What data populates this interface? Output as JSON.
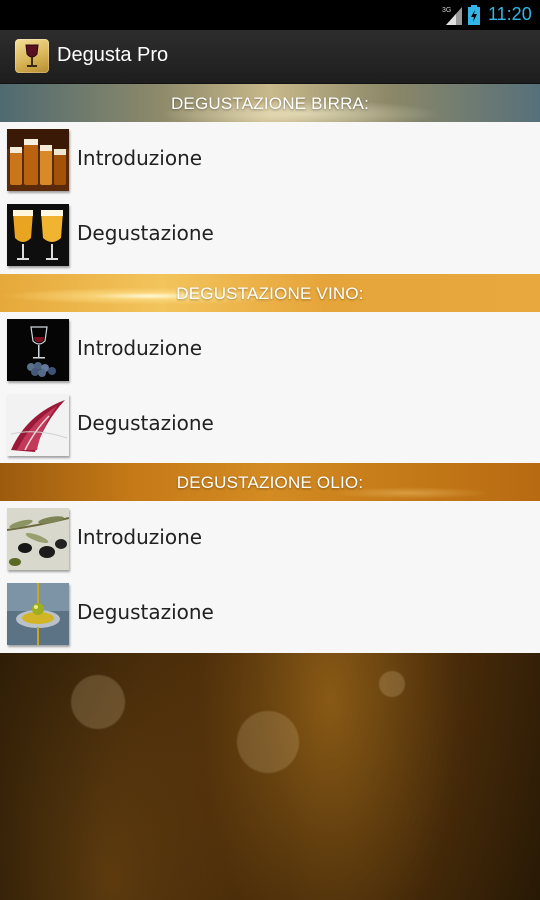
{
  "status_bar": {
    "network_label": "3G",
    "time": "11:20",
    "icons": [
      "signal-icon",
      "battery-icon"
    ]
  },
  "action_bar": {
    "app_icon": "wine-glass-icon",
    "title": "Degusta Pro"
  },
  "sections": [
    {
      "header": "DEGUSTAZIONE BIRRA:",
      "items": [
        {
          "label": "Introduzione",
          "thumbnail": "beer-glasses-image"
        },
        {
          "label": "Degustazione",
          "thumbnail": "beer-tasting-image"
        }
      ]
    },
    {
      "header": "DEGUSTAZIONE VINO:",
      "items": [
        {
          "label": "Introduzione",
          "thumbnail": "wine-glass-grapes-image"
        },
        {
          "label": "Degustazione",
          "thumbnail": "red-wine-swirl-image"
        }
      ]
    },
    {
      "header": "DEGUSTAZIONE OLIO:",
      "items": [
        {
          "label": "Introduzione",
          "thumbnail": "olives-branch-image"
        },
        {
          "label": "Degustazione",
          "thumbnail": "olive-oil-drop-image"
        }
      ]
    }
  ],
  "colors": {
    "status_time": "#33b5e5",
    "list_background": "#f7f7f7",
    "action_bar": "#2d2d2d"
  }
}
